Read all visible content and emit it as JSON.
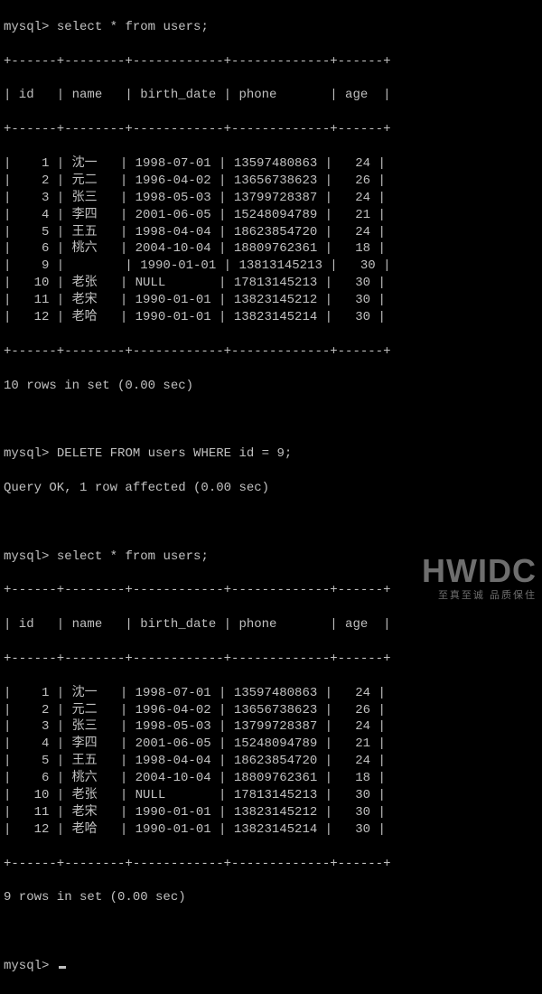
{
  "prompt": "mysql>",
  "queries": {
    "select1": "select * from users;",
    "delete": "DELETE FROM users WHERE id = 9;",
    "delete_result": "Query OK, 1 row affected (0.00 sec)",
    "select2": "select * from users;"
  },
  "columns": [
    "id",
    "name",
    "birth_date",
    "phone",
    "age"
  ],
  "border": "+------+--------+------------+-------------+------+",
  "header_line": "| id   | name   | birth_date | phone       | age  |",
  "table1": {
    "rows": [
      {
        "id": "1",
        "name": "沈一",
        "birth_date": "1998-07-01",
        "phone": "13597480863",
        "age": "24"
      },
      {
        "id": "2",
        "name": "元二",
        "birth_date": "1996-04-02",
        "phone": "13656738623",
        "age": "26"
      },
      {
        "id": "3",
        "name": "张三",
        "birth_date": "1998-05-03",
        "phone": "13799728387",
        "age": "24"
      },
      {
        "id": "4",
        "name": "李四",
        "birth_date": "2001-06-05",
        "phone": "15248094789",
        "age": "21"
      },
      {
        "id": "5",
        "name": "王五",
        "birth_date": "1998-04-04",
        "phone": "18623854720",
        "age": "24"
      },
      {
        "id": "6",
        "name": "桃六",
        "birth_date": "2004-10-04",
        "phone": "18809762361",
        "age": "18"
      },
      {
        "id": "9",
        "name": "",
        "birth_date": "1990-01-01",
        "phone": "13813145213",
        "age": "30"
      },
      {
        "id": "10",
        "name": "老张",
        "birth_date": "NULL",
        "phone": "17813145213",
        "age": "30"
      },
      {
        "id": "11",
        "name": "老宋",
        "birth_date": "1990-01-01",
        "phone": "13823145212",
        "age": "30"
      },
      {
        "id": "12",
        "name": "老哈",
        "birth_date": "1990-01-01",
        "phone": "13823145214",
        "age": "30"
      }
    ],
    "summary": "10 rows in set (0.00 sec)"
  },
  "table2": {
    "rows": [
      {
        "id": "1",
        "name": "沈一",
        "birth_date": "1998-07-01",
        "phone": "13597480863",
        "age": "24"
      },
      {
        "id": "2",
        "name": "元二",
        "birth_date": "1996-04-02",
        "phone": "13656738623",
        "age": "26"
      },
      {
        "id": "3",
        "name": "张三",
        "birth_date": "1998-05-03",
        "phone": "13799728387",
        "age": "24"
      },
      {
        "id": "4",
        "name": "李四",
        "birth_date": "2001-06-05",
        "phone": "15248094789",
        "age": "21"
      },
      {
        "id": "5",
        "name": "王五",
        "birth_date": "1998-04-04",
        "phone": "18623854720",
        "age": "24"
      },
      {
        "id": "6",
        "name": "桃六",
        "birth_date": "2004-10-04",
        "phone": "18809762361",
        "age": "18"
      },
      {
        "id": "10",
        "name": "老张",
        "birth_date": "NULL",
        "phone": "17813145213",
        "age": "30"
      },
      {
        "id": "11",
        "name": "老宋",
        "birth_date": "1990-01-01",
        "phone": "13823145212",
        "age": "30"
      },
      {
        "id": "12",
        "name": "老哈",
        "birth_date": "1990-01-01",
        "phone": "13823145214",
        "age": "30"
      }
    ],
    "summary": "9 rows in set (0.00 sec)"
  },
  "watermark": {
    "big": "HWIDC",
    "small": "至真至诚 品质保住"
  }
}
